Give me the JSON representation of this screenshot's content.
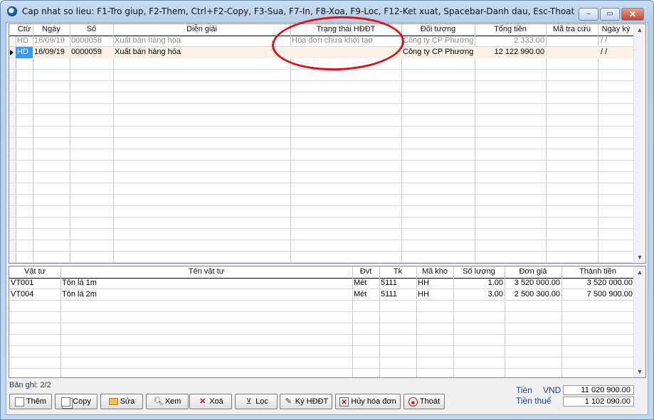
{
  "window": {
    "title": "Cap nhat so lieu: F1-Tro giup, F2-Them, Ctrl+F2-Copy, F3-Sua, F7-In, F8-Xoa, F9-Loc, F12-Ket xuat, Spacebar-Danh dau, Esc-Thoat",
    "minimize": "–",
    "maximize": "▭",
    "close": "✕"
  },
  "master": {
    "headers": [
      "Ctừ",
      "Ngày",
      "Số",
      "Diễn giải",
      "Trạng thái HĐĐT",
      "Đối tượng",
      "Tổng tiền",
      "Mã tra cứu",
      "Ngày ký"
    ],
    "rows": [
      {
        "ctu": "HD",
        "ngay": "16/09/19",
        "so": "0000058",
        "dien_giai": "Xuất bán hàng hóa",
        "trang_thai": "Hóa đơn chưa khởi tạo",
        "doi_tuong": "Công ty CP Phương t",
        "tong_tien": "2 333.00",
        "ma_tra_cuu": "",
        "ngay_ky": "/  /"
      },
      {
        "ctu": "HD",
        "ngay": "16/09/19",
        "so": "0000059",
        "dien_giai": "Xuất bán hàng hóa",
        "trang_thai": "",
        "doi_tuong": "Công ty CP Phương t",
        "tong_tien": "12 122 990.00",
        "ma_tra_cuu": "",
        "ngay_ky": "/  /"
      }
    ]
  },
  "detail": {
    "headers": [
      "Vật tư",
      "Tên vật tư",
      "Đvt",
      "Tk",
      "Mã kho",
      "Số lượng",
      "Đơn giá",
      "Thành tiền"
    ],
    "rows": [
      {
        "vat_tu": "VT001",
        "ten": "Tôn lá 1m",
        "dvt": "Mét",
        "tk": "5111",
        "kho": "HH",
        "so_luong": "1.00",
        "don_gia": "3 520 000.00",
        "thanh_tien": "3 520 000.00"
      },
      {
        "vat_tu": "VT004",
        "ten": "Tôn lá 2m",
        "dvt": "Mét",
        "tk": "5111",
        "kho": "HH",
        "so_luong": "3.00",
        "don_gia": "2 500 300.00",
        "thanh_tien": "7 500 900.00"
      }
    ]
  },
  "footer": {
    "record_info": "Bản ghi: 2/2",
    "buttons": [
      "Thêm",
      "Copy",
      "Sửa",
      "Xem",
      "Xoá",
      "Lọc",
      "Ký HĐĐT",
      "Hủy hóa đơn",
      "Thoát"
    ],
    "tien_label": "Tiền",
    "currency": "VND",
    "tien_value": "11 020 900.00",
    "tien_thue_label": "Tiền thuế",
    "tien_thue_value": "1 102 090.00"
  },
  "colors": {
    "highlight": "#e0101c",
    "selected_row": "#fdf1e6",
    "selected_cell": "#3399ff"
  }
}
